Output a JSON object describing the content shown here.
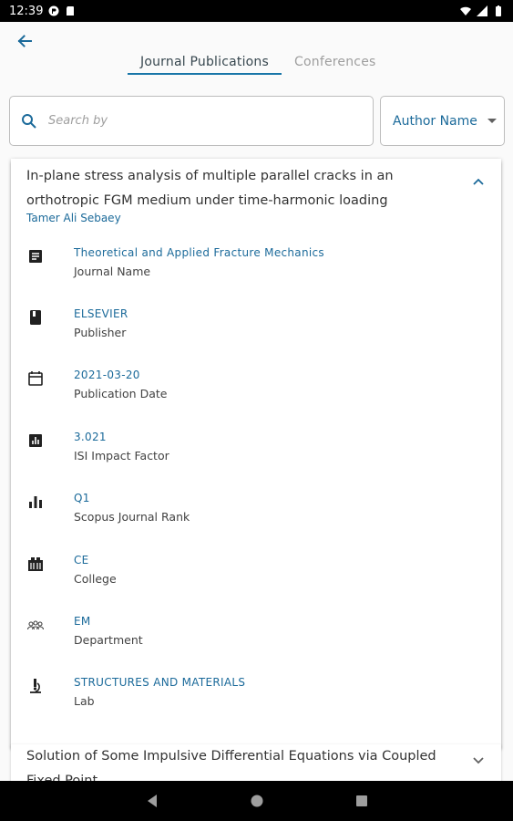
{
  "statusbar": {
    "time": "12:39"
  },
  "colors": {
    "accent": "#1b6a9a",
    "tab_underline": "#1976a8"
  },
  "tabs": [
    {
      "label": "Journal Publications",
      "active": true
    },
    {
      "label": "Conferences",
      "active": false
    }
  ],
  "search": {
    "placeholder": "Search by",
    "value": ""
  },
  "filter": {
    "selected": "Author Name"
  },
  "publications": [
    {
      "title": "In-plane stress analysis of multiple parallel cracks in an orthotropic FGM medium under time-harmonic loading",
      "author": "Tamer Ali Sebaey",
      "expanded": true,
      "details": [
        {
          "icon": "journal-icon",
          "value": "Theoretical and Applied Fracture Mechanics",
          "label": "Journal Name"
        },
        {
          "icon": "book-icon",
          "value": "ELSEVIER",
          "label": "Publisher"
        },
        {
          "icon": "calendar-icon",
          "value": "2021-03-20",
          "label": "Publication Date"
        },
        {
          "icon": "impact-chart-icon",
          "value": "3.021",
          "label": "ISI Impact Factor"
        },
        {
          "icon": "bar-chart-icon",
          "value": "Q1",
          "label": "Scopus Journal Rank"
        },
        {
          "icon": "college-icon",
          "value": "CE",
          "label": "College"
        },
        {
          "icon": "group-icon",
          "value": "EM",
          "label": "Department"
        },
        {
          "icon": "microscope-icon",
          "value": "STRUCTURES AND MATERIALS",
          "label": "Lab"
        }
      ]
    },
    {
      "title": "Solution of Some Impulsive Differential Equations via Coupled Fixed Point",
      "expanded": false
    }
  ]
}
